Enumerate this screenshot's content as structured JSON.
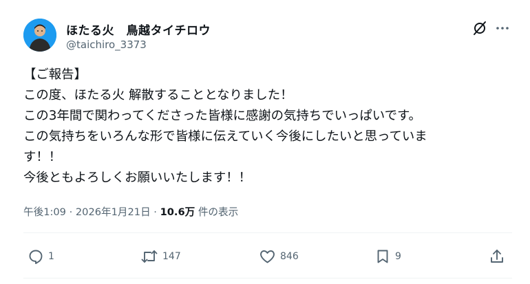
{
  "author": {
    "display_name": "ほたる火　鳥越タイチロウ",
    "handle": "@taichiro_3373"
  },
  "post": {
    "lines": [
      "【ご報告】",
      "この度、ほたる火 解散することとなりました！",
      "この3年間で関わってくださった皆様に感謝の気持ちでいっぱいです。",
      "この気持ちをいろんな形で皆様に伝えていく今後にしたいと思っていま",
      "す！！",
      "今後ともよろしくお願いいたします！！"
    ]
  },
  "meta": {
    "time": "午後1:09",
    "separator": " · ",
    "date": "2026年1月21日",
    "views_count": "10.6万",
    "views_label": " 件の表示"
  },
  "actions": {
    "reply_count": "1",
    "repost_count": "147",
    "like_count": "846",
    "bookmark_count": "9"
  },
  "icons": {
    "header": [
      "grok-icon",
      "more-icon"
    ],
    "actions": [
      "reply-icon",
      "repost-icon",
      "like-icon",
      "bookmark-icon",
      "share-icon"
    ]
  },
  "colors": {
    "text": "#0f1419",
    "secondary": "#536471",
    "avatar_bg": "#1d9bf0"
  }
}
